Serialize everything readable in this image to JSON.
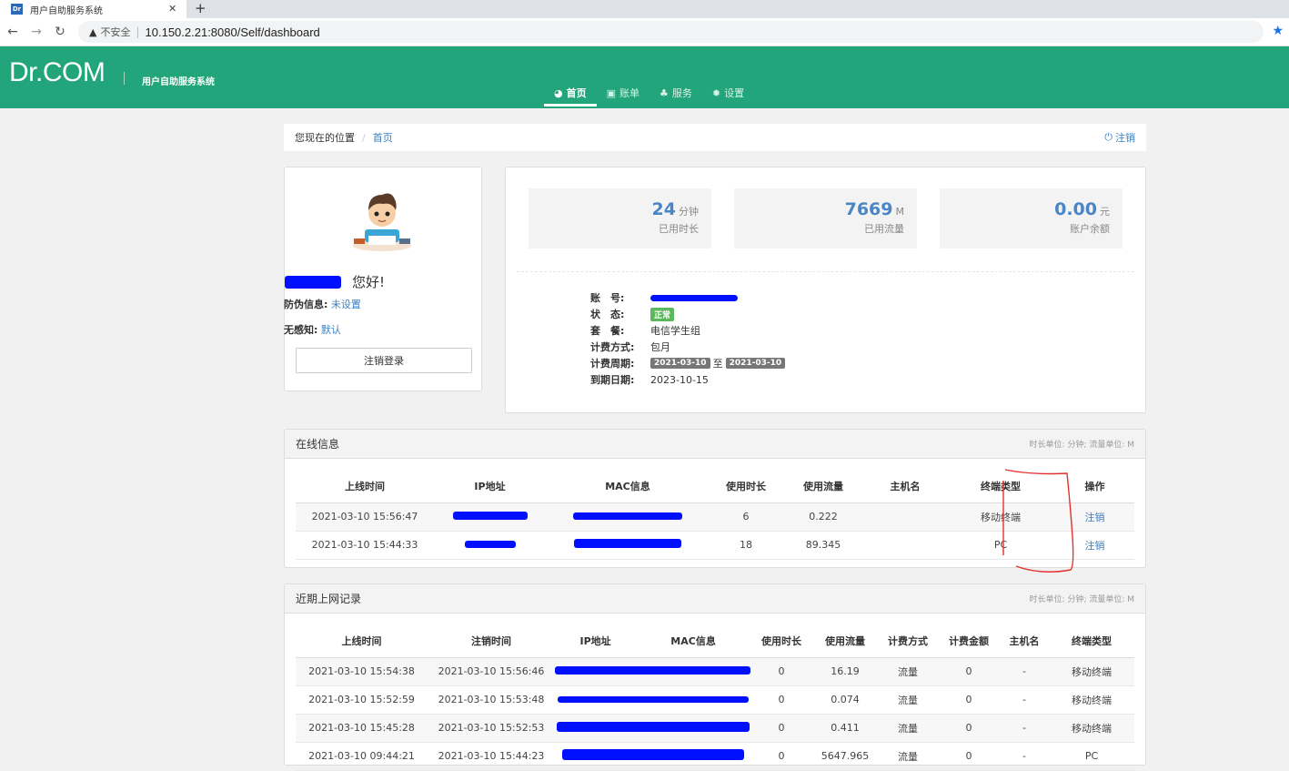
{
  "browser": {
    "tab_title": "用户自助服务系统",
    "favicon_text": "Dr",
    "security_label": "不安全",
    "url": "10.150.2.21:8080/Self/dashboard"
  },
  "header": {
    "logo": "Dr.COM",
    "subtitle": "用户自助服务系统",
    "nav": [
      {
        "label": "首页",
        "icon": "dashboard-icon",
        "active": true
      },
      {
        "label": "账单",
        "icon": "bill-icon",
        "active": false
      },
      {
        "label": "服务",
        "icon": "sitemap-icon",
        "active": false
      },
      {
        "label": "设置",
        "icon": "gear-icon",
        "active": false
      }
    ]
  },
  "breadcrumb": {
    "prefix": "您现在的位置",
    "separator": "/",
    "current": "首页",
    "logout": "注销"
  },
  "profile": {
    "greeting": "您好!",
    "anti_fraud_label": "防伪信息:",
    "anti_fraud_value": "未设置",
    "seamless_label": "无感知:",
    "seamless_value": "默认",
    "logout_button": "注销登录"
  },
  "stats": [
    {
      "value": "24",
      "unit": "分钟",
      "label": "已用时长"
    },
    {
      "value": "7669",
      "unit": "M",
      "label": "已用流量"
    },
    {
      "value": "0.00",
      "unit": "元",
      "label": "账户余额"
    }
  ],
  "account": {
    "account_label": "账　号:",
    "status_label": "状　态:",
    "status_value": "正常",
    "package_label": "套　餐:",
    "package_value": "电信学生组",
    "billing_method_label": "计费方式:",
    "billing_method_value": "包月",
    "billing_period_label": "计费周期:",
    "period_start": "2021-03-10",
    "period_to": "至",
    "period_end": "2021-03-10",
    "expiry_label": "到期日期:",
    "expiry_value": "2023-10-15"
  },
  "online": {
    "title": "在线信息",
    "unit_note": "时长单位: 分钟; 流量单位: M",
    "columns": [
      "上线时间",
      "IP地址",
      "MAC信息",
      "使用时长",
      "使用流量",
      "主机名",
      "终端类型",
      "操作"
    ],
    "rows": [
      {
        "login": "2021-03-10 15:56:47",
        "duration": "6",
        "traffic": "0.222",
        "host": "",
        "terminal": "移动终端",
        "action": "注销"
      },
      {
        "login": "2021-03-10 15:44:33",
        "duration": "18",
        "traffic": "89.345",
        "host": "",
        "terminal": "PC",
        "action": "注销"
      }
    ]
  },
  "history": {
    "title": "近期上网记录",
    "unit_note": "时长单位: 分钟; 流量单位: M",
    "columns": [
      "上线时间",
      "注销时间",
      "IP地址",
      "MAC信息",
      "使用时长",
      "使用流量",
      "计费方式",
      "计费金额",
      "主机名",
      "终端类型"
    ],
    "rows": [
      {
        "login": "2021-03-10 15:54:38",
        "logout": "2021-03-10 15:56:46",
        "duration": "0",
        "traffic": "16.19",
        "method": "流量",
        "amount": "0",
        "host": "-",
        "terminal": "移动终端"
      },
      {
        "login": "2021-03-10 15:52:59",
        "logout": "2021-03-10 15:53:48",
        "duration": "0",
        "traffic": "0.074",
        "method": "流量",
        "amount": "0",
        "host": "-",
        "terminal": "移动终端"
      },
      {
        "login": "2021-03-10 15:45:28",
        "logout": "2021-03-10 15:52:53",
        "duration": "0",
        "traffic": "0.411",
        "method": "流量",
        "amount": "0",
        "host": "-",
        "terminal": "移动终端"
      },
      {
        "login": "2021-03-10 09:44:21",
        "logout": "2021-03-10 15:44:23",
        "duration": "0",
        "traffic": "5647.965",
        "method": "流量",
        "amount": "0",
        "host": "-",
        "terminal": "PC"
      }
    ]
  }
}
